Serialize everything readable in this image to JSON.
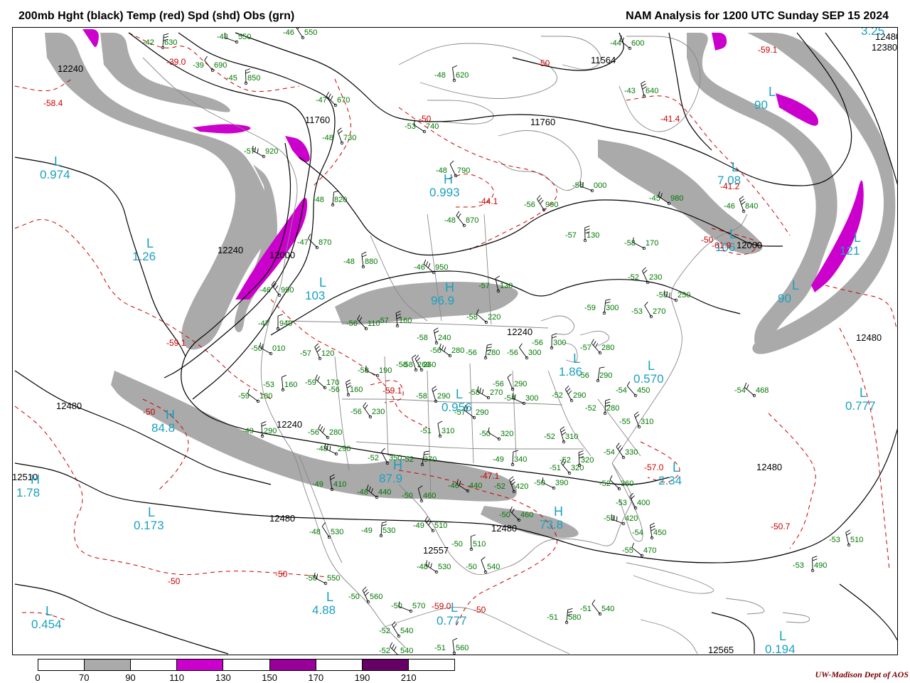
{
  "header": {
    "left": "200mb Hght (black) Temp (red) Spd (shd) Obs (grn)",
    "right": "NAM Analysis for 1200 UTC Sunday  SEP 15 2024"
  },
  "colors": {
    "height": "#000000",
    "temp": "#cc0000",
    "speed70": "#aaaaaa",
    "speed110": "#cc00cc",
    "speed150": "#990099",
    "speed190": "#660066",
    "obs": "#007700",
    "center_label": "#1aa0c0",
    "geography": "#888888"
  },
  "legend": {
    "ticks": [
      "0",
      "70",
      "90",
      "110",
      "130",
      "150",
      "170",
      "190",
      "210"
    ],
    "fills": [
      "#ffffff",
      "#aaaaaa",
      "#ffffff",
      "#cc00cc",
      "#ffffff",
      "#990099",
      "#ffffff",
      "#660066",
      "#ffffff"
    ]
  },
  "credit": {
    "org": "UW-Madison",
    "dept": "Dept of AOS"
  },
  "height_labels": [
    "12240",
    "11760",
    "11564",
    "11760",
    "12380",
    "12240",
    "12000",
    "12000",
    "12240",
    "12480",
    "12240",
    "12480",
    "12510",
    "12480",
    "12480",
    "12565",
    "12480",
    "12557",
    "12480"
  ],
  "centers": [
    {
      "t": "L",
      "v": "0.974"
    },
    {
      "t": "L",
      "v": "1.26"
    },
    {
      "t": "H",
      "v": "0.993"
    },
    {
      "t": "L",
      "v": "7.08"
    },
    {
      "t": "L",
      "v": "106"
    },
    {
      "t": "L",
      "v": "121"
    },
    {
      "t": "L",
      "v": "90"
    },
    {
      "t": "L",
      "v": "90"
    },
    {
      "t": "L",
      "v": "3.25"
    },
    {
      "t": "L",
      "v": "103"
    },
    {
      "t": "H",
      "v": "96.9"
    },
    {
      "t": "L",
      "v": "1.86"
    },
    {
      "t": "L",
      "v": "0.570"
    },
    {
      "t": "L",
      "v": "0.956"
    },
    {
      "t": "H",
      "v": "84.8"
    },
    {
      "t": "H",
      "v": "87.9"
    },
    {
      "t": "L",
      "v": "2.34"
    },
    {
      "t": "L",
      "v": "0.777"
    },
    {
      "t": "H",
      "v": "73.8"
    },
    {
      "t": "L",
      "v": "0.173"
    },
    {
      "t": "L",
      "v": "4.88"
    },
    {
      "t": "L",
      "v": "0.777"
    },
    {
      "t": "L",
      "v": "0.454"
    },
    {
      "t": "L",
      "v": "0.194"
    },
    {
      "t": "H",
      "v": "1.78"
    }
  ],
  "temp_labels": [
    "-58.4",
    "-39.0",
    "-44.1",
    "-41.4",
    "-59.1",
    "-41.2",
    "-61.9",
    "-59.1",
    "-50",
    "-50",
    "-59.1",
    "-50",
    "-47.1",
    "-57.0",
    "-50.7",
    "-50",
    "-50",
    "-50",
    "-59.0",
    "-50"
  ],
  "obs": [
    [
      "-43",
      "550"
    ],
    [
      "-46",
      "550"
    ],
    [
      "-42",
      "630"
    ],
    [
      "-39",
      "690"
    ],
    [
      "-45",
      "850"
    ],
    [
      "-47",
      "670"
    ],
    [
      "-48",
      "620"
    ],
    [
      "-44",
      "600"
    ],
    [
      "-43",
      "640"
    ],
    [
      "-53",
      "740"
    ],
    [
      "-48",
      "730"
    ],
    [
      "-57",
      "920"
    ],
    [
      "-48",
      "790"
    ],
    [
      "-56",
      "000"
    ],
    [
      "-56",
      "990"
    ],
    [
      "-48",
      "820"
    ],
    [
      "-48",
      "870"
    ],
    [
      "-57",
      "130"
    ],
    [
      "-47",
      "870"
    ],
    [
      "-48",
      "880"
    ],
    [
      "-46",
      "950"
    ],
    [
      "-57",
      "130"
    ],
    [
      "-45",
      "980"
    ],
    [
      "-46",
      "840"
    ],
    [
      "-58",
      "170"
    ],
    [
      "-52",
      "230"
    ],
    [
      "-55",
      "250"
    ],
    [
      "-53",
      "270"
    ],
    [
      "-59",
      "300"
    ],
    [
      "-46",
      "990"
    ],
    [
      "-47",
      "940"
    ],
    [
      "-56",
      "110"
    ],
    [
      "-57",
      "160"
    ],
    [
      "-58",
      "220"
    ],
    [
      "-58",
      "240"
    ],
    [
      "-56",
      "280"
    ],
    [
      "-58",
      "260"
    ],
    [
      "-50",
      "010"
    ],
    [
      "-57",
      "120"
    ],
    [
      "-58",
      "190"
    ],
    [
      "-58",
      "260"
    ],
    [
      "-56",
      "280"
    ],
    [
      "-56",
      "300"
    ],
    [
      "-56",
      "300"
    ],
    [
      "-57",
      "280"
    ],
    [
      "-53",
      "160"
    ],
    [
      "-59",
      "170"
    ],
    [
      "-56",
      "160"
    ],
    [
      "-59",
      "180"
    ],
    [
      "-58",
      "290"
    ],
    [
      "-58",
      "270"
    ],
    [
      "-56",
      "290"
    ],
    [
      "-54",
      "300"
    ],
    [
      "-52",
      "290"
    ],
    [
      "-56",
      "290"
    ],
    [
      "-56",
      "230"
    ],
    [
      "-52",
      "280"
    ],
    [
      "-54",
      "450"
    ],
    [
      "-49",
      "290"
    ],
    [
      "-56",
      "280"
    ],
    [
      "-51",
      "310"
    ],
    [
      "-57",
      "290"
    ],
    [
      "-52",
      "310"
    ],
    [
      "-50",
      "320"
    ],
    [
      "-55",
      "310"
    ],
    [
      "-48",
      "290"
    ],
    [
      "-52",
      "350"
    ],
    [
      "-52",
      "370"
    ],
    [
      "-54",
      "330"
    ],
    [
      "-49",
      "340"
    ],
    [
      "-51",
      "320"
    ],
    [
      "-52",
      "320"
    ],
    [
      "-52",
      "360"
    ],
    [
      "-49",
      "410"
    ],
    [
      "-48",
      "440"
    ],
    [
      "-50",
      "460"
    ],
    [
      "-46",
      "440"
    ],
    [
      "-52",
      "420"
    ],
    [
      "-50",
      "390"
    ],
    [
      "-53",
      "400"
    ],
    [
      "-53",
      "420"
    ],
    [
      "-48",
      "530"
    ],
    [
      "-49",
      "530"
    ],
    [
      "-49",
      "510"
    ],
    [
      "-50",
      "510"
    ],
    [
      "-50",
      "460"
    ],
    [
      "-54",
      "450"
    ],
    [
      "-55",
      "470"
    ],
    [
      "-53",
      "510"
    ],
    [
      "-48",
      "530"
    ],
    [
      "-50",
      "540"
    ],
    [
      "-50",
      "550"
    ],
    [
      "-50",
      "560"
    ],
    [
      "-50",
      "570"
    ],
    [
      "-52",
      "540"
    ],
    [
      "-51",
      "580"
    ],
    [
      "-51",
      "540"
    ],
    [
      "-53",
      "490"
    ],
    [
      "-52",
      "540"
    ],
    [
      "-51",
      "560"
    ],
    [
      "-54",
      "468"
    ]
  ]
}
